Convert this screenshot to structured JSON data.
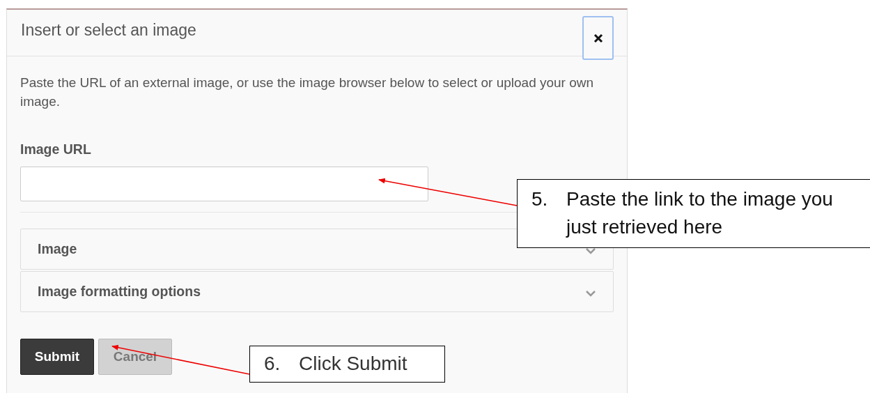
{
  "dialog": {
    "title": "Insert or select an image",
    "description": "Paste the URL of an external image, or use the image browser below to select or upload your own image.",
    "field": {
      "label": "Image URL"
    },
    "sections": [
      {
        "label": "Image",
        "expanded": false
      },
      {
        "label": "Image formatting options",
        "expanded": false
      }
    ],
    "buttons": [
      {
        "label": "Submit",
        "kind": "primary"
      },
      {
        "label": "Cancel",
        "kind": "secondary"
      }
    ]
  },
  "callouts": [
    {
      "number": "5.",
      "text": "Paste the link to the image you just retrieved here"
    },
    {
      "number": "6.",
      "text": "Click Submit"
    }
  ]
}
